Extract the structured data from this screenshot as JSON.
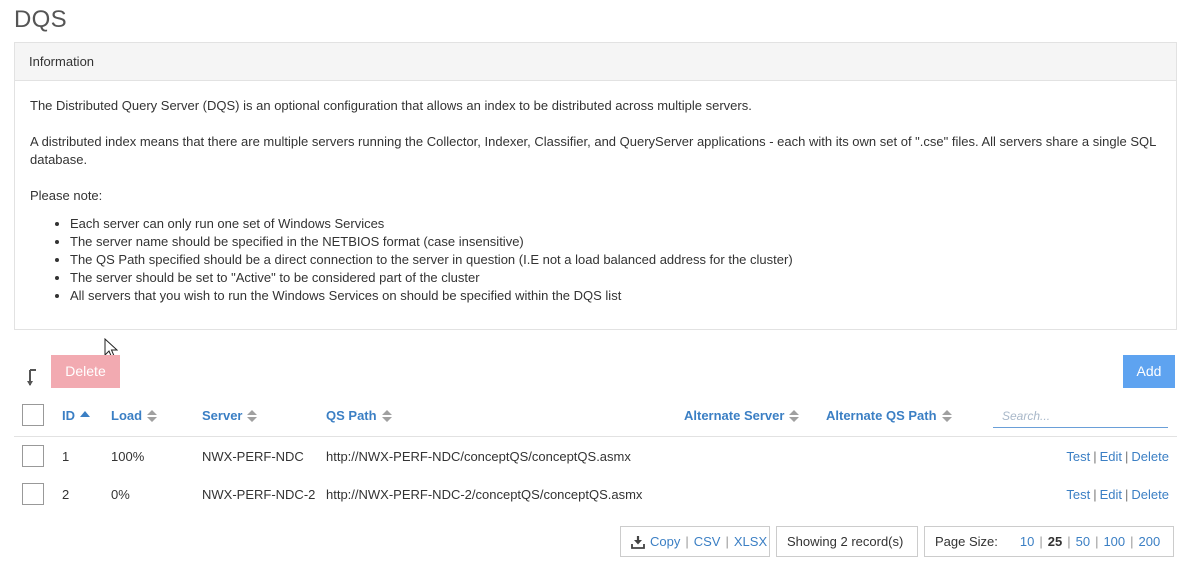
{
  "page": {
    "title": "DQS"
  },
  "info_panel": {
    "heading": "Information",
    "paragraph1": "The Distributed Query Server (DQS) is an optional configuration that allows an index to be distributed across multiple servers.",
    "paragraph2": "A distributed index means that there are multiple servers running the Collector, Indexer, Classifier, and QueryServer applications - each with its own set of \".cse\" files. All servers share a single SQL database.",
    "note_label": "Please note:",
    "notes": [
      "Each server can only run one set of Windows Services",
      "The server name should be specified in the NETBIOS format (case insensitive)",
      "The QS Path specified should be a direct connection to the server in question (I.E not a load balanced address for the cluster)",
      "The server should be set to \"Active\" to be considered part of the cluster",
      "All servers that you wish to run the Windows Services on should be specified within the DQS list"
    ]
  },
  "toolbar": {
    "delete_label": "Delete",
    "add_label": "Add"
  },
  "table": {
    "columns": {
      "id": "ID",
      "load": "Load",
      "server": "Server",
      "qs_path": "QS Path",
      "alt_server": "Alternate Server",
      "alt_qs_path": "Alternate QS Path"
    },
    "search_placeholder": "Search...",
    "rows": [
      {
        "id": "1",
        "load": "100%",
        "server": "NWX-PERF-NDC",
        "qs_path": "http://NWX-PERF-NDC/conceptQS/conceptQS.asmx",
        "alt_server": "",
        "alt_qs_path": ""
      },
      {
        "id": "2",
        "load": "0%",
        "server": "NWX-PERF-NDC-2",
        "qs_path": "http://NWX-PERF-NDC-2/conceptQS/conceptQS.asmx",
        "alt_server": "",
        "alt_qs_path": ""
      }
    ],
    "row_actions": {
      "test": "Test",
      "edit": "Edit",
      "delete": "Delete",
      "separator": "|"
    }
  },
  "footer": {
    "export": {
      "copy": "Copy",
      "csv": "CSV",
      "xlsx": "XLSX"
    },
    "record_count": "Showing 2 record(s)",
    "page_size_label": "Page Size:",
    "page_sizes": [
      "10",
      "25",
      "50",
      "100",
      "200"
    ],
    "current_page_size": "25"
  },
  "colors": {
    "link": "#3b7fc4",
    "add_button": "#5ea3f0",
    "delete_button_disabled": "#f2aab1"
  },
  "icons": {
    "sort": "sort-down-icon",
    "download": "download-icon",
    "cursor": "mouse-pointer-icon"
  }
}
